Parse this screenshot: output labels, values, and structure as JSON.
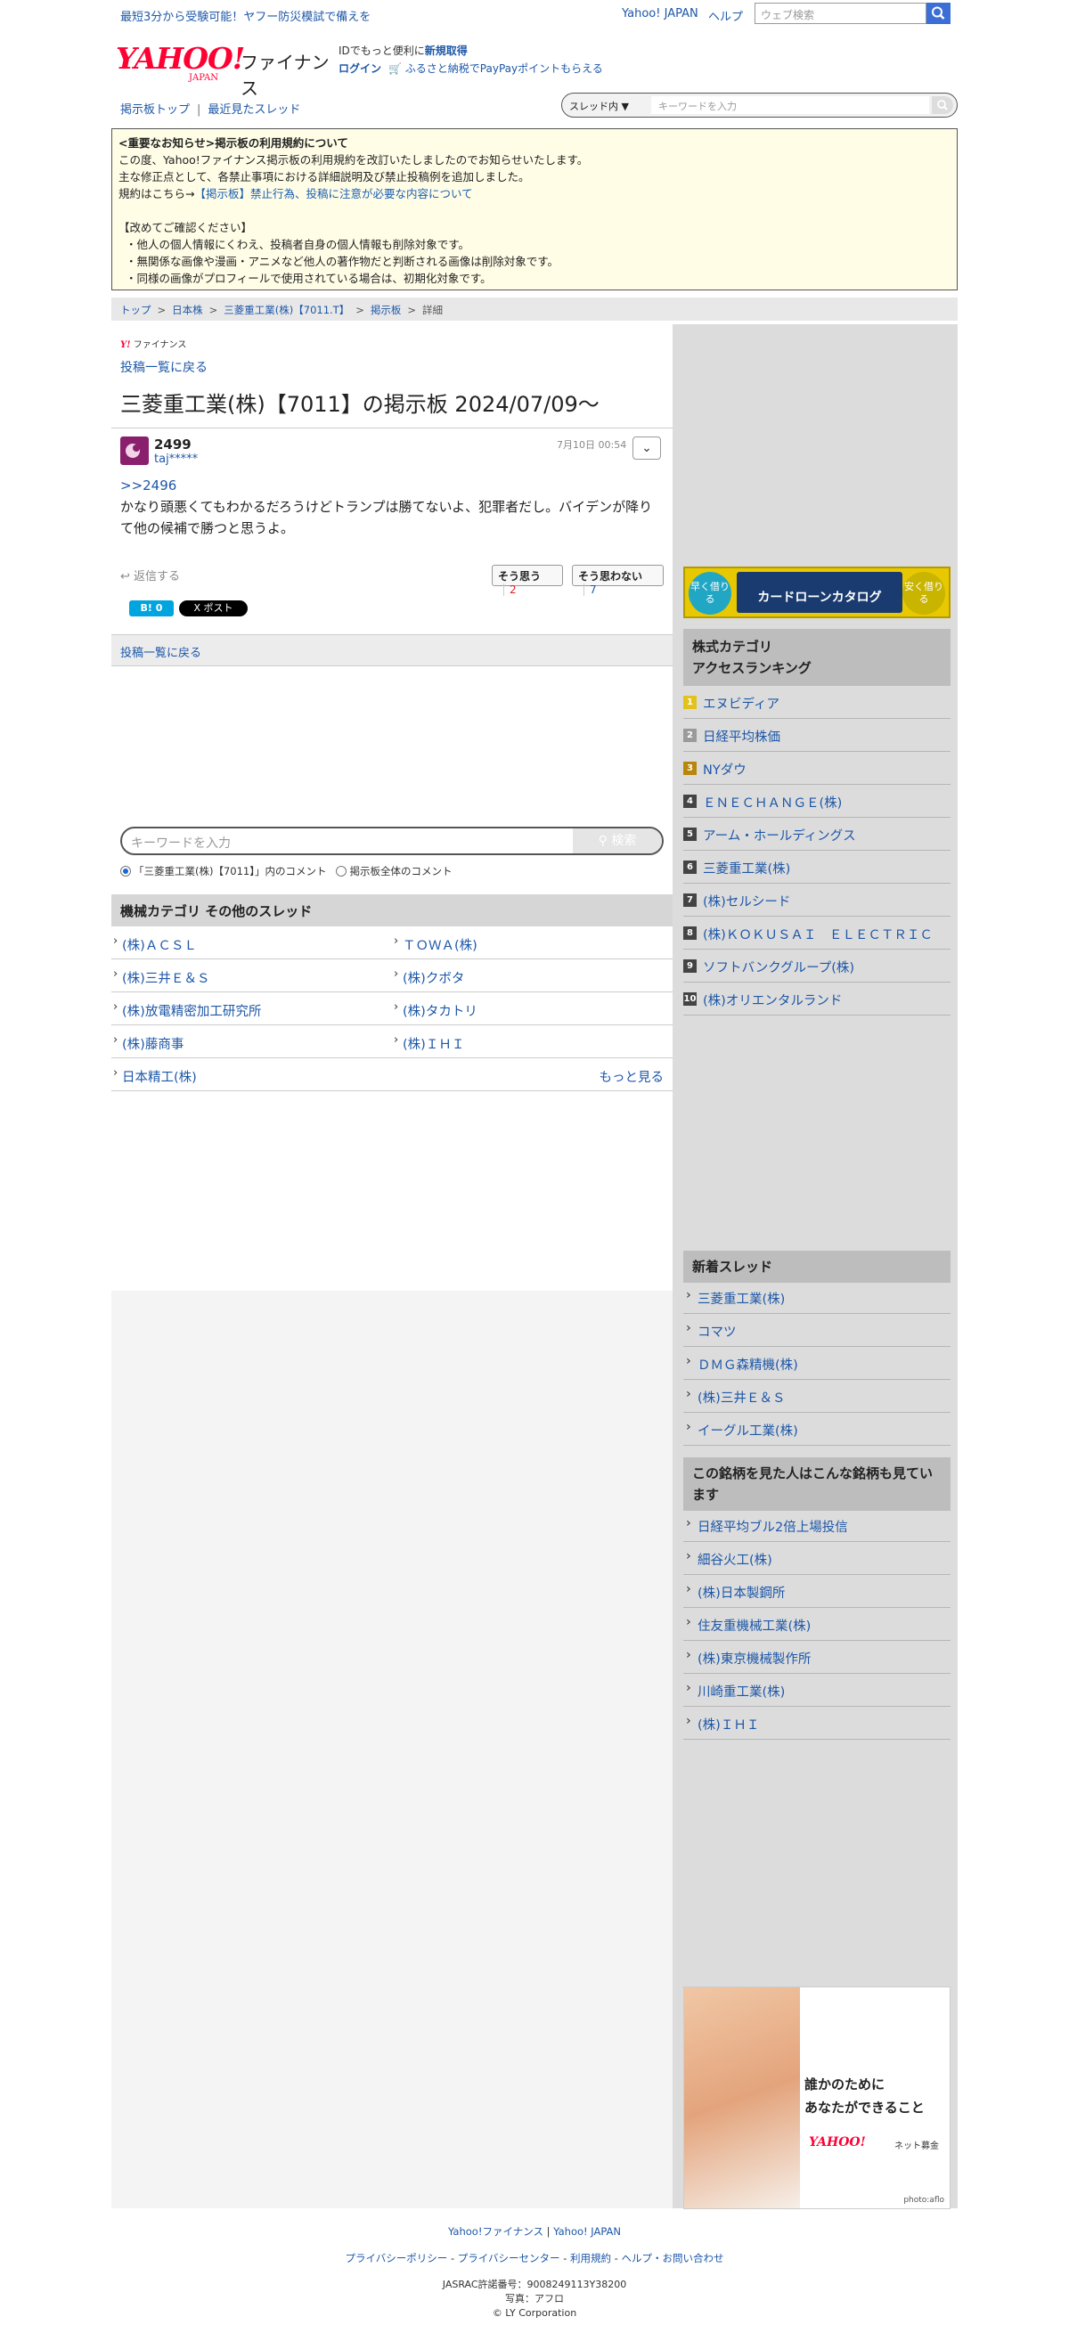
{
  "topbar": {
    "promo": "最短3分から受験可能！ヤフー防災模試で備えを",
    "yahoo_japan": "Yahoo! JAPAN",
    "help": "ヘルプ",
    "search_placeholder": "ウェブ検索"
  },
  "header": {
    "logo_word": "YAHOO!",
    "logo_sub": "JAPAN",
    "logo_finance": "ファイナンス",
    "id_text": "IDでもっと便利に",
    "register": "新規取得",
    "login": "ログイン",
    "furusato": "ふるさと納税でPayPayポイントもらえる"
  },
  "nav": {
    "board_top": "掲示板トップ",
    "recent": "最近見たスレッド",
    "scope": "スレッド内",
    "keyword_placeholder": "キーワードを入力"
  },
  "notice": {
    "title": "<重要なお知らせ>掲示板の利用規約について",
    "line1": "この度、Yahoo!ファイナンス掲示板の利用規約を改訂いたしましたのでお知らせいたします。",
    "line2": "主な修正点として、各禁止事項における詳細説明及び禁止投稿例を追加しました。",
    "line3_prefix": "規約はこちら→",
    "line3_link": "【掲示板】禁止行為、投稿に注意が必要な内容について",
    "check_title": "【改めてご確認ください】",
    "items": [
      "・他人の個人情報にくわえ、投稿者自身の個人情報も削除対象です。",
      "・無関係な画像や漫画・アニメなど他人の著作物だと判断される画像は削除対象です。",
      "・同様の画像がプロフィールで使用されている場合は、初期化対象です。"
    ]
  },
  "breadcrumb": [
    "トップ",
    "日本株",
    "三菱重工業(株)【7011.T】",
    "掲示板",
    "詳細"
  ],
  "main": {
    "mini_logo": "ファイナンス",
    "back_link": "投稿一覧に戻る",
    "title": "三菱重工業(株)【7011】の掲示板 2024/07/09〜",
    "post": {
      "number": "2499",
      "user": "taj*****",
      "date": "7月10日 00:54",
      "ref": ">>2496",
      "body": "かなり頭悪くてもわかるだろうけどトランプは勝てないよ、犯罪者だし。バイデンが降りて他の候補で勝つと思うよ。",
      "reply": "返信する",
      "agree_label": "そう思う",
      "agree_count": "2",
      "disagree_label": "そう思わない",
      "disagree_count": "7",
      "hatena": "B! 0",
      "xpost": "X ポスト"
    },
    "back_link2": "投稿一覧に戻る",
    "keyword_placeholder": "キーワードを入力",
    "search_button": "検索",
    "scope_thread": "「三菱重工業(株)【7011】」内のコメント",
    "scope_all": "掲示板全体のコメント",
    "category_title": "機械カテゴリ その他のスレッド",
    "categories": [
      "(株)ＡＣＳＬ",
      "ＴＯＷＡ(株)",
      "(株)三井Ｅ＆Ｓ",
      "(株)クボタ",
      "(株)放電精密加工研究所",
      "(株)タカトリ",
      "(株)藤商事",
      "(株)ＩＨＩ",
      "日本精工(株)"
    ],
    "more": "もっと見る"
  },
  "side": {
    "ad1_left": "早く借りる",
    "ad1_center": "カードローンカタログ",
    "ad1_right": "安く借りる",
    "ranking_title_1": "株式カテゴリ",
    "ranking_title_2": "アクセスランキング",
    "ranking": [
      {
        "n": "1",
        "name": "エヌビディア",
        "color": "#e3c21c"
      },
      {
        "n": "2",
        "name": "日経平均株価",
        "color": "#9a9a9a"
      },
      {
        "n": "3",
        "name": "NYダウ",
        "color": "#b8860b"
      },
      {
        "n": "4",
        "name": "ＥＮＥＣＨＡＮＧＥ(株)",
        "color": "#444444"
      },
      {
        "n": "5",
        "name": "アーム・ホールディングス",
        "color": "#444444"
      },
      {
        "n": "6",
        "name": "三菱重工業(株)",
        "color": "#444444"
      },
      {
        "n": "7",
        "name": "(株)セルシード",
        "color": "#444444"
      },
      {
        "n": "8",
        "name": "(株)ＫＯＫＵＳＡＩ　ＥＬＥＣＴＲＩＣ",
        "color": "#444444"
      },
      {
        "n": "9",
        "name": "ソフトバンクグループ(株)",
        "color": "#444444"
      },
      {
        "n": "10",
        "name": "(株)オリエンタルランド",
        "color": "#444444"
      }
    ],
    "new_title": "新着スレッド",
    "new_threads": [
      "三菱重工業(株)",
      "コマツ",
      "ＤＭＧ森精機(株)",
      "(株)三井Ｅ＆Ｓ",
      "イーグル工業(株)"
    ],
    "viewed_title": "この銘柄を見た人はこんな銘柄も見ています",
    "viewed": [
      "日経平均ブル2倍上場投信",
      "細谷火工(株)",
      "(株)日本製鋼所",
      "住友重機械工業(株)",
      "(株)東京機械製作所",
      "川崎重工業(株)",
      "(株)ＩＨＩ"
    ],
    "ad2_line1": "誰かのために",
    "ad2_line2": "あなたができること",
    "ad2_logo": "YAHOO!",
    "ad2_logo_sub": "ネット募金",
    "ad2_credit": "photo:aflo"
  },
  "footer": {
    "finance": "Yahoo!ファイナンス",
    "yahoo_japan": "Yahoo! JAPAN",
    "links": [
      "プライバシーポリシー",
      "プライバシーセンター",
      "利用規約",
      "ヘルプ・お問い合わせ"
    ],
    "jasrac": "JASRAC許諾番号：9008249113Y38200",
    "photo": "写真：アフロ",
    "copyright": "© LY Corporation"
  }
}
